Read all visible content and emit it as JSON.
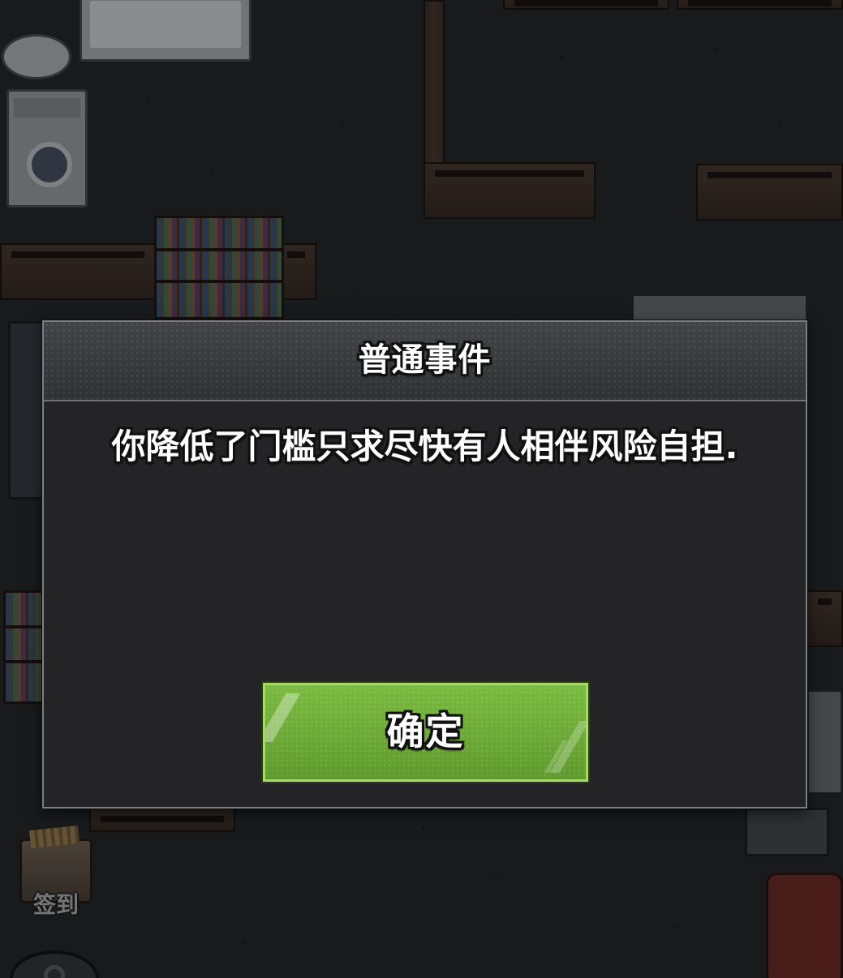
{
  "dialog": {
    "title": "普通事件",
    "message": "你降低了门槛只求尽快有人相伴风险自担.",
    "confirm_label": "确定"
  },
  "hud": {
    "checkin_label": "签到"
  },
  "colors": {
    "dialog_background": "#242427",
    "dialog_border": "#7c7f83",
    "confirm_button": "#6aa436",
    "confirm_border": "#a6d86a",
    "text": "#ffffff",
    "text_outline": "#111111"
  }
}
